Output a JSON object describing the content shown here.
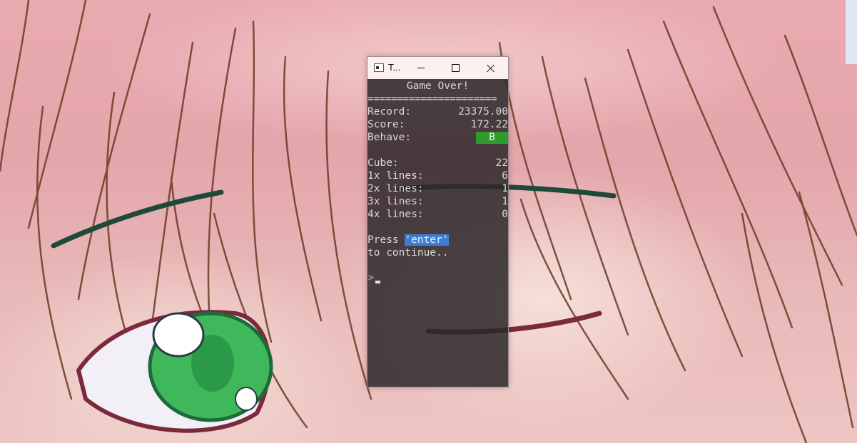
{
  "window": {
    "title": "T..."
  },
  "console": {
    "heading": "Game Over!",
    "separator": "======================",
    "stats": [
      {
        "label": "Record:",
        "value": "23375.00"
      },
      {
        "label": "Score:",
        "value": "172.22"
      }
    ],
    "behave": {
      "label": "Behave:",
      "value": "B"
    },
    "counts": [
      {
        "label": "Cube:",
        "value": "22"
      },
      {
        "label": "1x lines:",
        "value": "6"
      },
      {
        "label": "2x lines:",
        "value": "1"
      },
      {
        "label": "3x lines:",
        "value": "1"
      },
      {
        "label": "4x lines:",
        "value": "0"
      }
    ],
    "prompt": {
      "press": "Press ",
      "key": "'enter'",
      "continue": "to continue..",
      "glyph": ">"
    }
  },
  "colors": {
    "behave_badge": "#2f9a2c",
    "key_highlight": "#3d7fd6"
  },
  "icons": {
    "app": "console-app-icon",
    "minimize": "minimize-icon",
    "maximize": "maximize-icon",
    "close": "close-icon"
  }
}
